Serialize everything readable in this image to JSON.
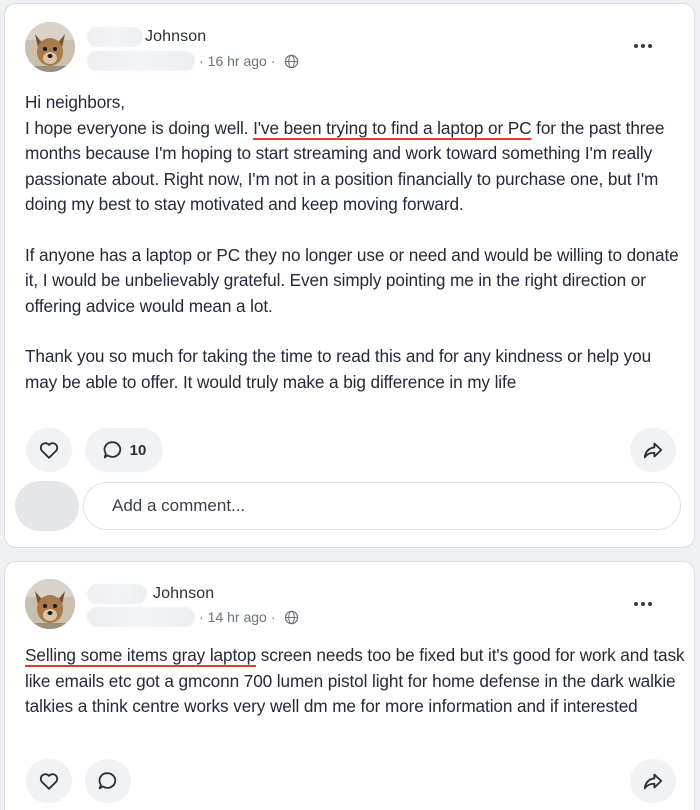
{
  "posts": [
    {
      "author_name": "Johnson",
      "timestamp": "16 hr ago",
      "separator": "·",
      "body_pre_highlight": "Hi neighbors,",
      "para1_intro": "I hope everyone is doing well. ",
      "para1_highlight": "I've been trying to find a laptop or PC",
      "para1_rest": " for the past three months because I'm hoping to start streaming and work toward something I'm really passionate about. Right now, I'm not in a position financially to purchase one, but I'm doing my best to stay motivated and keep moving forward.",
      "para2": "If anyone has a laptop or PC they no longer use or need and would be willing to donate it, I would be unbelievably grateful. Even simply pointing me in the right direction or offering advice would mean a lot.",
      "para3": "Thank you so much for taking the time to read this and for any kindness or help you may be able to offer. It would truly make a big difference in my life",
      "comment_count": "10",
      "comment_placeholder": "Add a comment..."
    },
    {
      "author_name": "Johnson",
      "timestamp": "14 hr ago",
      "separator": "·",
      "body_highlight": "Selling some items gray laptop",
      "body_rest": " screen needs too be fixed but it's good for work and task like emails etc got a gmconn 700 lumen pistol light for home defense in the dark walkie talkies a think centre works very well dm me for more information and if interested"
    }
  ],
  "icons": {
    "like": "heart-icon",
    "comment": "comment-bubble-icon",
    "share": "share-arrow-icon",
    "privacy": "globe-icon",
    "more": "more-options-icon"
  },
  "colors": {
    "highlight_underline": "#e03b34",
    "card_bg": "#ffffff",
    "page_bg": "#eef0f3",
    "button_bg": "#f0f2f5"
  }
}
